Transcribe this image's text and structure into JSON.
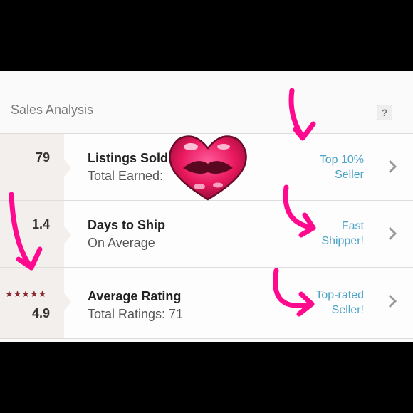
{
  "header": {
    "title": "Sales Analysis",
    "help_label": "?"
  },
  "rows": [
    {
      "value": "79",
      "label": "Listings Sold",
      "sub": "Total Earned:",
      "badge_line1": "Top 10%",
      "badge_line2": "Seller"
    },
    {
      "value": "1.4",
      "label": "Days to Ship",
      "sub": "On Average",
      "badge_line1": "Fast",
      "badge_line2": "Shipper!"
    },
    {
      "value": "4.9",
      "stars": "★★★★★",
      "rating_stars": 5,
      "label": "Average Rating",
      "sub": "Total Ratings: 71",
      "badge_line1": "Top-rated",
      "badge_line2": "Seller!"
    }
  ],
  "icons": [
    "help-icon",
    "chevron-right-icon",
    "star-icon",
    "lips-sticker",
    "pink-arrow"
  ],
  "colors": {
    "accent": "#4ba3c7",
    "stars": "#8a2a33",
    "arrow": "#ff0a8f",
    "lips": "#e8175d"
  }
}
